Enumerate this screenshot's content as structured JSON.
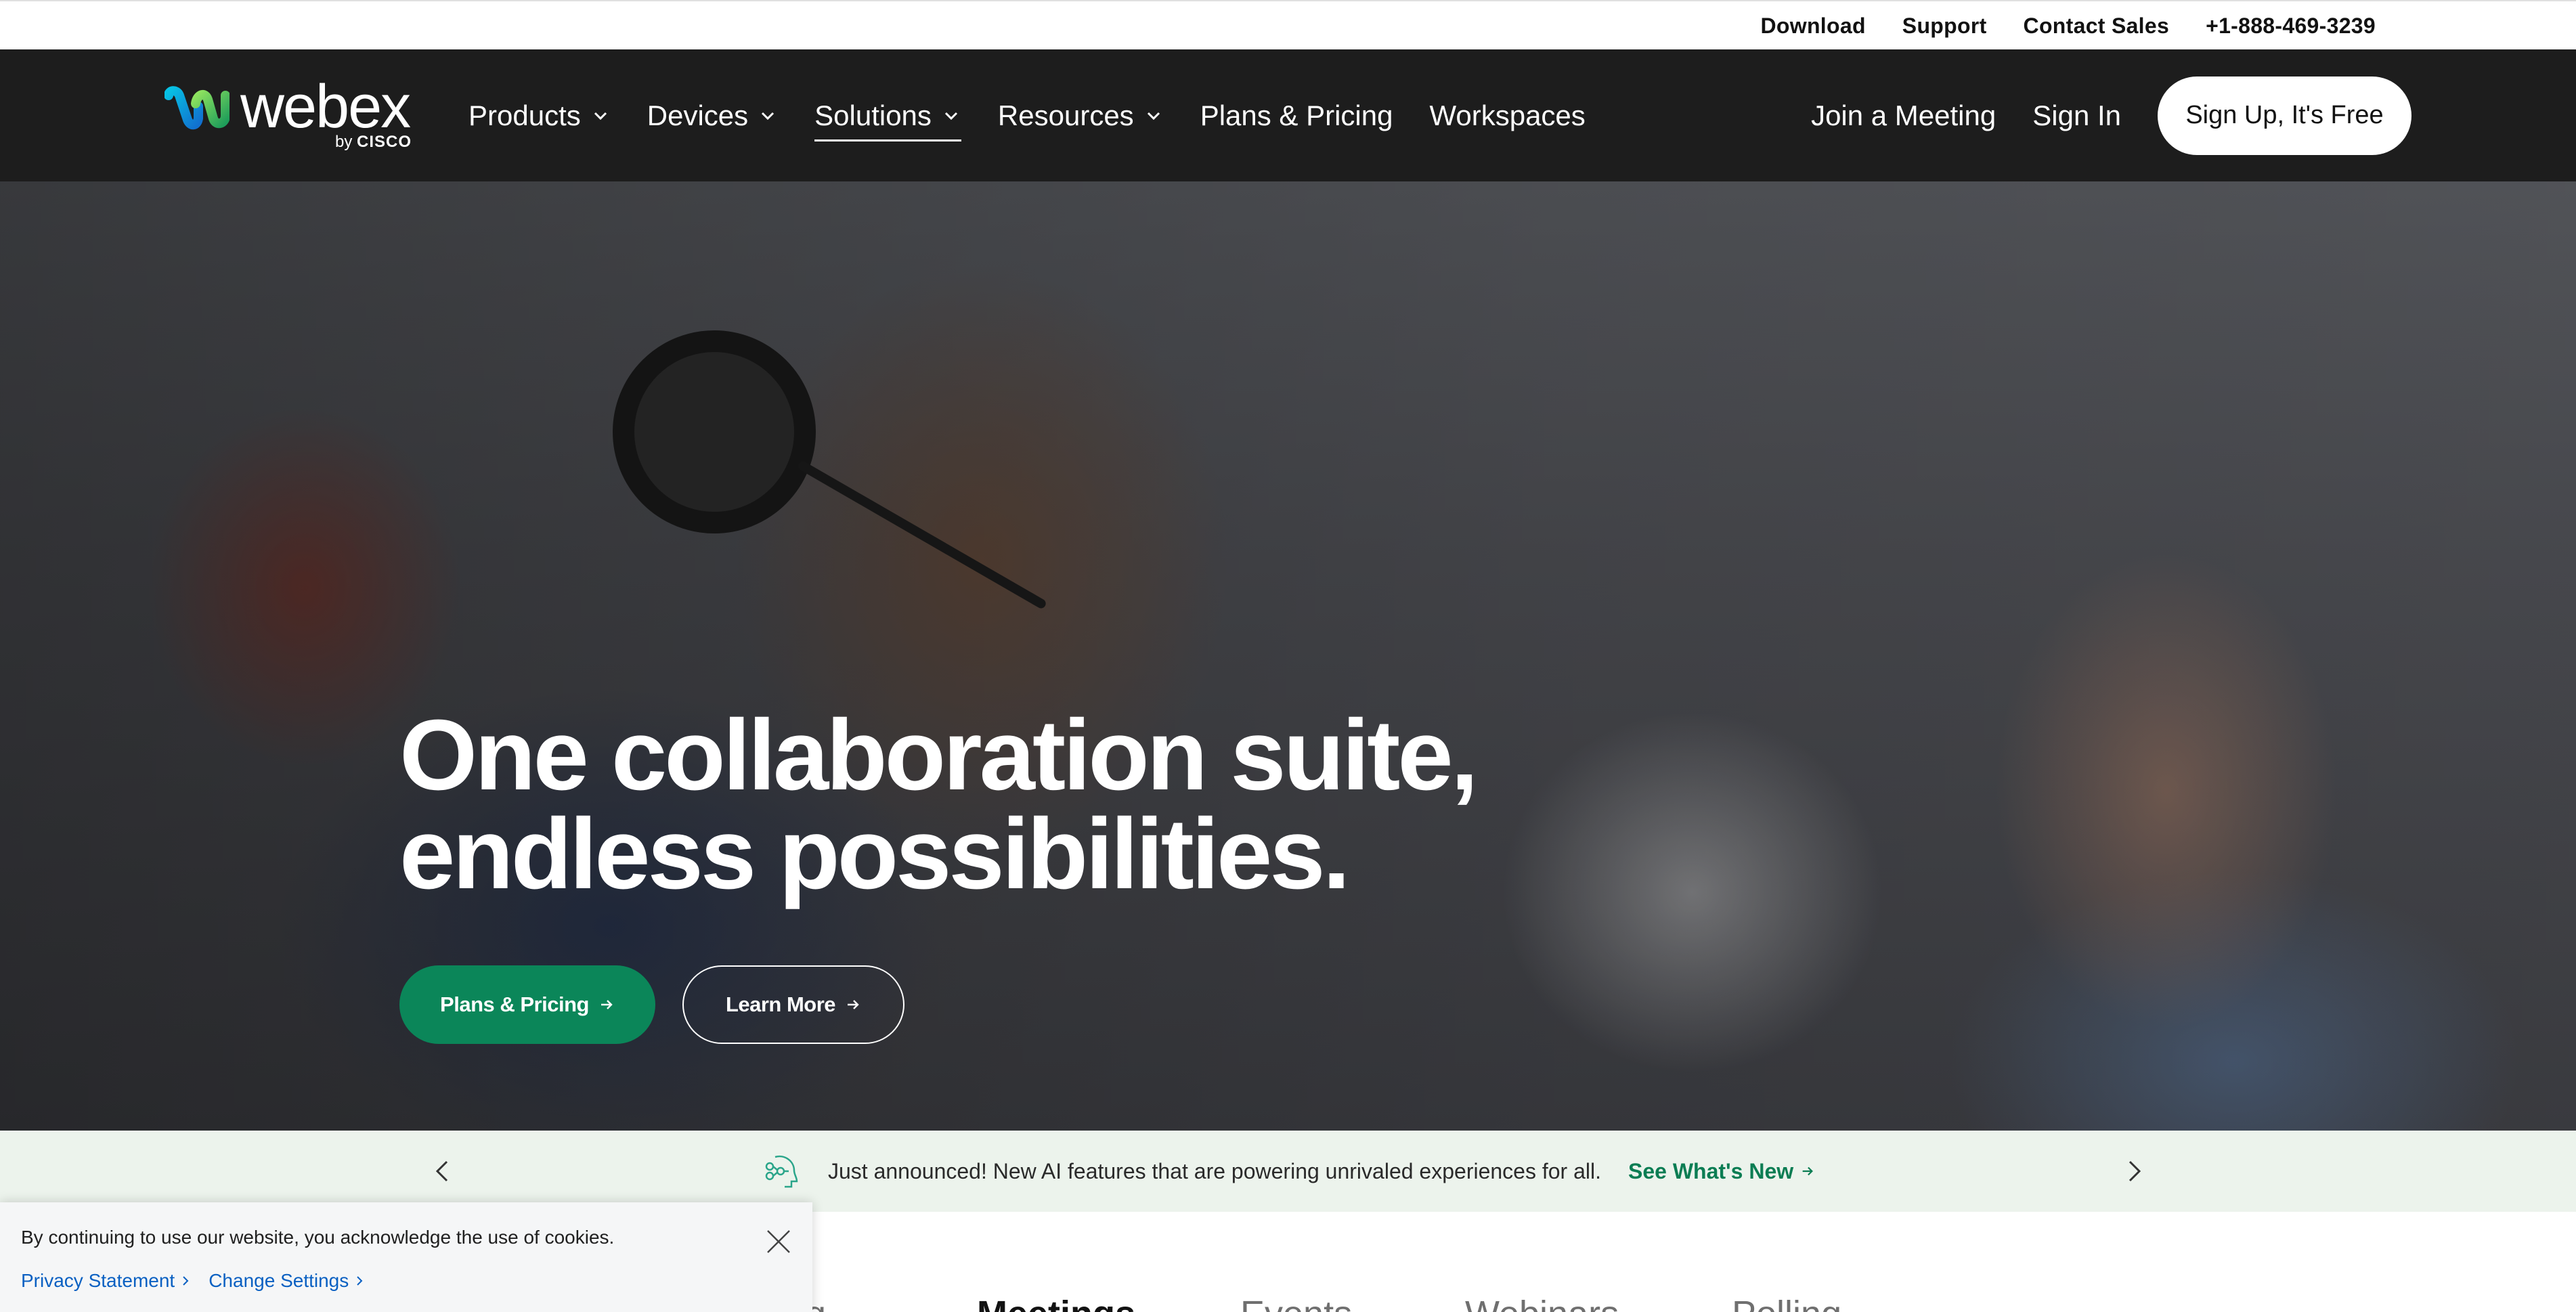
{
  "utility_bar": {
    "download": "Download",
    "support": "Support",
    "contact_sales": "Contact Sales",
    "phone": "+1-888-469-3239"
  },
  "nav": {
    "logo_text": "webex",
    "logo_by": "by",
    "logo_brand": "CISCO",
    "items": [
      {
        "label": "Products"
      },
      {
        "label": "Devices"
      },
      {
        "label": "Solutions"
      },
      {
        "label": "Resources"
      },
      {
        "label": "Plans & Pricing"
      },
      {
        "label": "Workspaces"
      }
    ],
    "join_meeting": "Join a Meeting",
    "sign_in": "Sign In",
    "signup": "Sign Up, It's Free"
  },
  "hero": {
    "title_line1": "One collaboration suite,",
    "title_line2": "endless possibilities.",
    "primary_button": "Plans & Pricing",
    "secondary_button": "Learn More"
  },
  "announcement": {
    "text": "Just announced! New AI features that are powering unrivaled experiences for all.",
    "link": "See What's New"
  },
  "tabs": [
    {
      "label": "ng"
    },
    {
      "label": "Meetings"
    },
    {
      "label": "Events"
    },
    {
      "label": "Webinars"
    },
    {
      "label": "Polling"
    }
  ],
  "cookie": {
    "text": "By continuing to use our website, you acknowledge the use of cookies.",
    "privacy": "Privacy Statement",
    "settings": "Change Settings"
  },
  "colors": {
    "nav_bg": "#1d1d1d",
    "primary_green": "#0b8659",
    "announce_bg": "#ecf3ec",
    "link_blue": "#0a60c2"
  }
}
